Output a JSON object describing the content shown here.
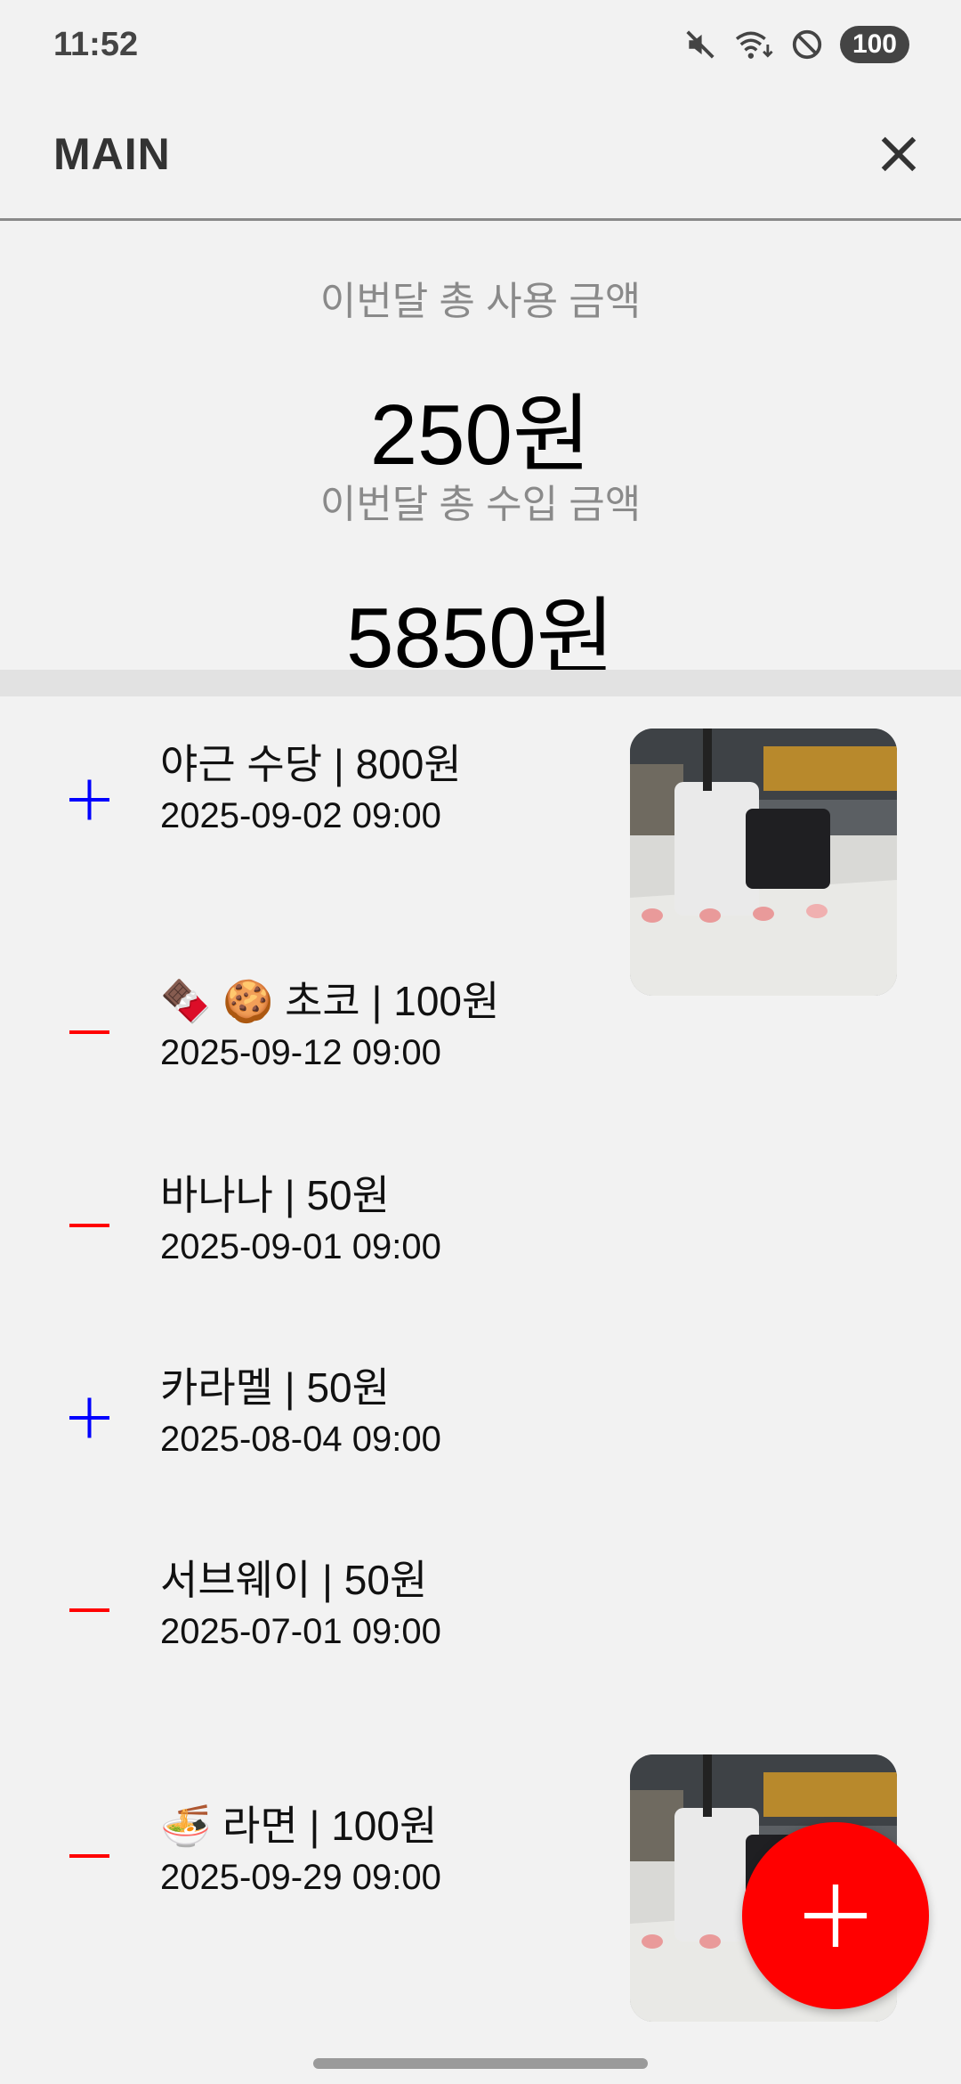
{
  "status_bar": {
    "time": "11:52",
    "battery": "100"
  },
  "app_bar": {
    "title": "MAIN"
  },
  "summary": {
    "spent_label": "이번달 총 사용 금액",
    "spent_value": "250원",
    "income_label": "이번달 총 수입 금액",
    "income_value": "5850원"
  },
  "colors": {
    "plus": "#0000ff",
    "minus": "#ff0000",
    "fab": "#ff0000"
  },
  "transactions": [
    {
      "type": "income",
      "title": "야근 수당 | 800원",
      "date": "2025-09-02 09:00",
      "has_image": true
    },
    {
      "type": "expense",
      "title": "🍫 🍪 초코 | 100원",
      "date": "2025-09-12 09:00",
      "has_image": false
    },
    {
      "type": "expense",
      "title": "바나나 | 50원",
      "date": "2025-09-01 09:00",
      "has_image": false
    },
    {
      "type": "income",
      "title": "카라멜 | 50원",
      "date": "2025-08-04 09:00",
      "has_image": false
    },
    {
      "type": "expense",
      "title": "서브웨이 | 50원",
      "date": "2025-07-01 09:00",
      "has_image": false
    },
    {
      "type": "expense",
      "title": "🍜 라면 | 100원",
      "date": "2025-09-29 09:00",
      "has_image": true
    }
  ],
  "icons": {
    "close": "close-icon",
    "fab": "plus-icon",
    "mute": "mute-icon",
    "wifi": "wifi-icon",
    "dnd": "do-not-disturb-icon"
  }
}
